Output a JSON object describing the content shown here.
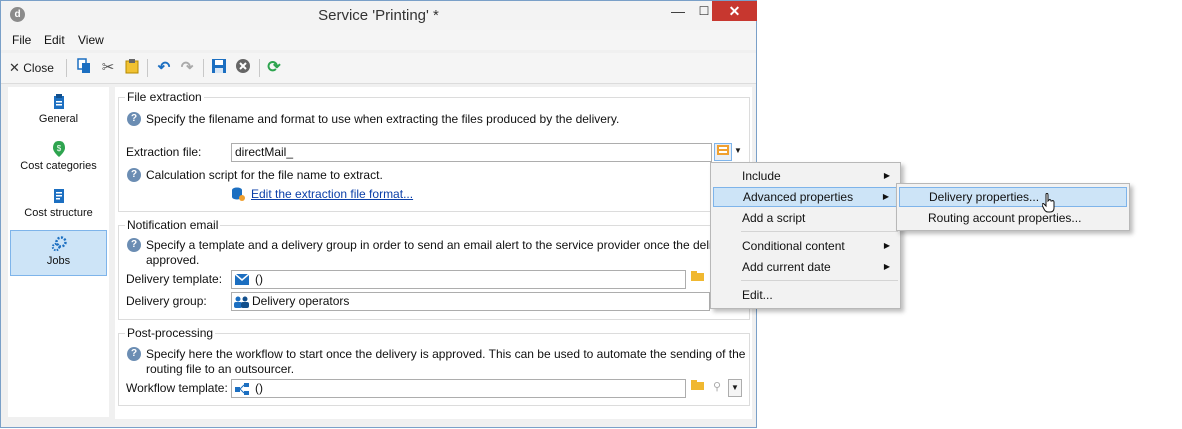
{
  "window": {
    "title": "Service 'Printing' *",
    "minimize": "—",
    "maximize": "☐",
    "close": "✕"
  },
  "menu": [
    "File",
    "Edit",
    "View"
  ],
  "toolbar": {
    "close_label": "Close"
  },
  "nav": [
    {
      "label": "General",
      "icon": "clipboard-icon"
    },
    {
      "label": "Cost categories",
      "icon": "dollar-icon"
    },
    {
      "label": "Cost structure",
      "icon": "document-icon"
    },
    {
      "label": "Jobs",
      "icon": "gears-icon"
    }
  ],
  "extraction": {
    "title": "File extraction",
    "help": "Specify the filename and format to use when extracting the files produced by the delivery.",
    "file_label": "Extraction file:",
    "file_value": "directMail_",
    "calc_help": "Calculation script for the file name to extract.",
    "edit_link": "Edit the extraction file format..."
  },
  "notification": {
    "title": "Notification email",
    "help_line1": "Specify a template and a delivery group in order to send an email alert to the service provider once the delivery is",
    "help_line2": "approved.",
    "template_label": "Delivery template:",
    "template_value": "()",
    "group_label": "Delivery group:",
    "group_value": "Delivery operators"
  },
  "postprocessing": {
    "title": "Post-processing",
    "help_line1": "Specify here the workflow to start once the delivery is approved. This can be used to automate the sending of the",
    "help_line2": "routing file to an outsourcer.",
    "workflow_label": "Workflow template:",
    "workflow_value": "()"
  },
  "context_menu": {
    "items": [
      "Include",
      "Advanced properties",
      "Add a script",
      "Conditional content",
      "Add current date",
      "Edit..."
    ],
    "submenu": [
      "Delivery properties...",
      "Routing account properties..."
    ]
  },
  "colors": {
    "accent": "#1c6fc1",
    "highlight": "#cde4f7",
    "close_red": "#c7372f"
  }
}
